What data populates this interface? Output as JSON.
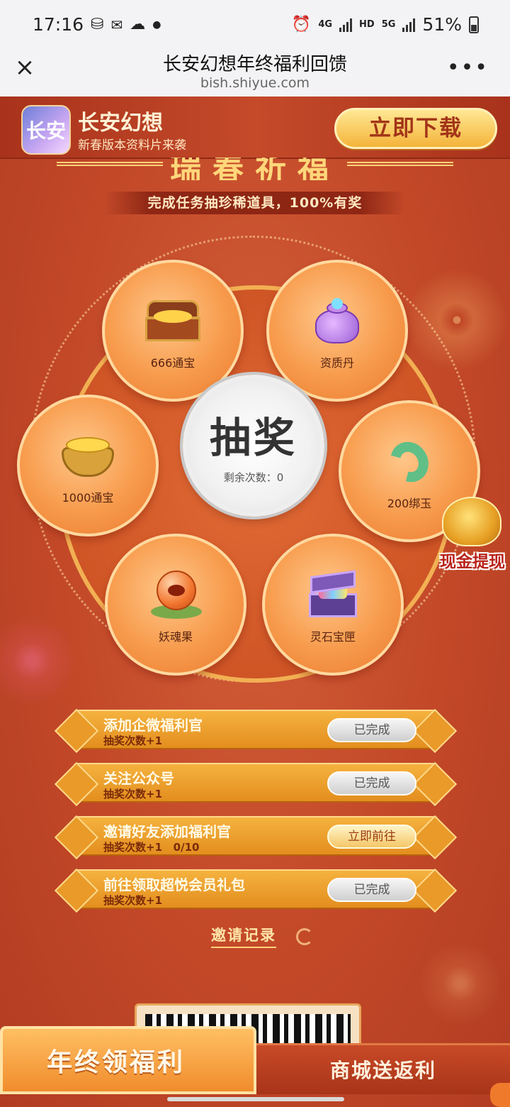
{
  "status_bar": {
    "time": "17:16",
    "left_icons": [
      "wechat-icon",
      "notification-icon",
      "cloud-icon",
      "dot-icon"
    ],
    "network_4g": "4G",
    "hd": "HD",
    "network_5g": "5G",
    "battery": "51%"
  },
  "browser": {
    "title": "长安幻想年终福利回馈",
    "url": "bish.shiyue.com",
    "close_symbol": "×",
    "more_symbol": "•••"
  },
  "banner": {
    "app_icon_text": "长安",
    "app_name": "长安幻想",
    "app_subtitle": "新春版本资料片来袭",
    "download_label": "立即下载"
  },
  "event": {
    "header_partial": "瑞春祈福",
    "subtitle": "完成任务抽珍稀道具，100%有奖"
  },
  "wheel": {
    "prizes": [
      {
        "label": "666通宝",
        "icon": "treasure-chest-icon"
      },
      {
        "label": "资质丹",
        "icon": "pill-bag-icon"
      },
      {
        "label": "200绑玉",
        "icon": "jade-icon"
      },
      {
        "label": "灵石宝匣",
        "icon": "gem-box-icon"
      },
      {
        "label": "妖魂果",
        "icon": "spirit-fruit-icon"
      },
      {
        "label": "1000通宝",
        "icon": "gold-pot-icon"
      }
    ],
    "draw_label": "抽奖",
    "remaining": "剩余次数：0",
    "cash_label": "现金提现"
  },
  "tasks": [
    {
      "title": "添加企微福利官",
      "reward": "抽奖次数+1",
      "button": "已完成",
      "state": "done"
    },
    {
      "title": "关注公众号",
      "reward": "抽奖次数+1",
      "button": "已完成",
      "state": "done"
    },
    {
      "title": "邀请好友添加福利官",
      "reward": "抽奖次数+1   0/10",
      "button": "立即前往",
      "state": "go"
    },
    {
      "title": "前往领取超悦会员礼包",
      "reward": "抽奖次数+1",
      "button": "已完成",
      "state": "done"
    }
  ],
  "invite_record": "邀请记录",
  "bottom_tabs": {
    "left": "年终领福利",
    "right": "商城送返利"
  },
  "colors": {
    "background": "#c0472a",
    "gold": "#f4b43a",
    "petal": "#f79a4b"
  }
}
